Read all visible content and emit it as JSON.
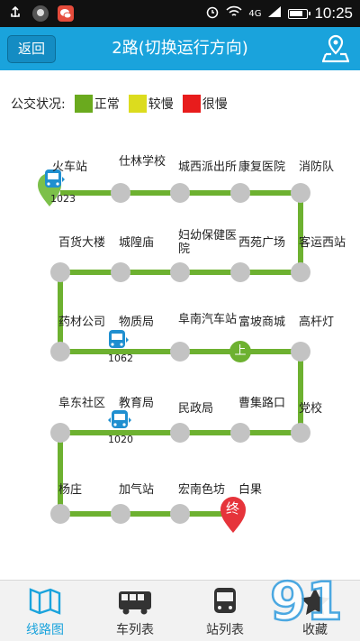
{
  "header": {
    "back_label": "返回",
    "title": "2路(切换运行方向)"
  },
  "statusbar": {
    "time": "10:25",
    "network": "4G"
  },
  "legend": {
    "label": "公交状况:",
    "items": [
      {
        "label": "正常",
        "color": "#6aaa1e"
      },
      {
        "label": "较慢",
        "color": "#dcdc1e"
      },
      {
        "label": "很慢",
        "color": "#e81c1c"
      }
    ]
  },
  "stations": [
    "火车站",
    "仕林学校",
    "城西派出所",
    "康复医院",
    "消防队",
    "客运西站",
    "西苑广场",
    "妇幼保健医院",
    "城隍庙",
    "百货大楼",
    "药材公司",
    "物质局",
    "阜南汽车站",
    "富坡商城",
    "高杆灯",
    "党校",
    "曹集路口",
    "民政局",
    "教育局",
    "阜东社区",
    "杨庄",
    "加气站",
    "宏南色坊",
    "白果"
  ],
  "buses": [
    {
      "number": "1023"
    },
    {
      "number": "1062"
    },
    {
      "number": "1020"
    }
  ],
  "markers": {
    "board": "上",
    "end": "终"
  },
  "tabs": [
    {
      "label": "线路图",
      "icon": "route-map-icon"
    },
    {
      "label": "车列表",
      "icon": "bus-list-icon"
    },
    {
      "label": "站列表",
      "icon": "station-list-icon"
    },
    {
      "label": "收藏",
      "icon": "favorite-star-icon"
    }
  ],
  "colors": {
    "header": "#1aa3dc",
    "route": "#6db130",
    "node": "#c3c3c3",
    "bus": "#1f8fd0"
  }
}
